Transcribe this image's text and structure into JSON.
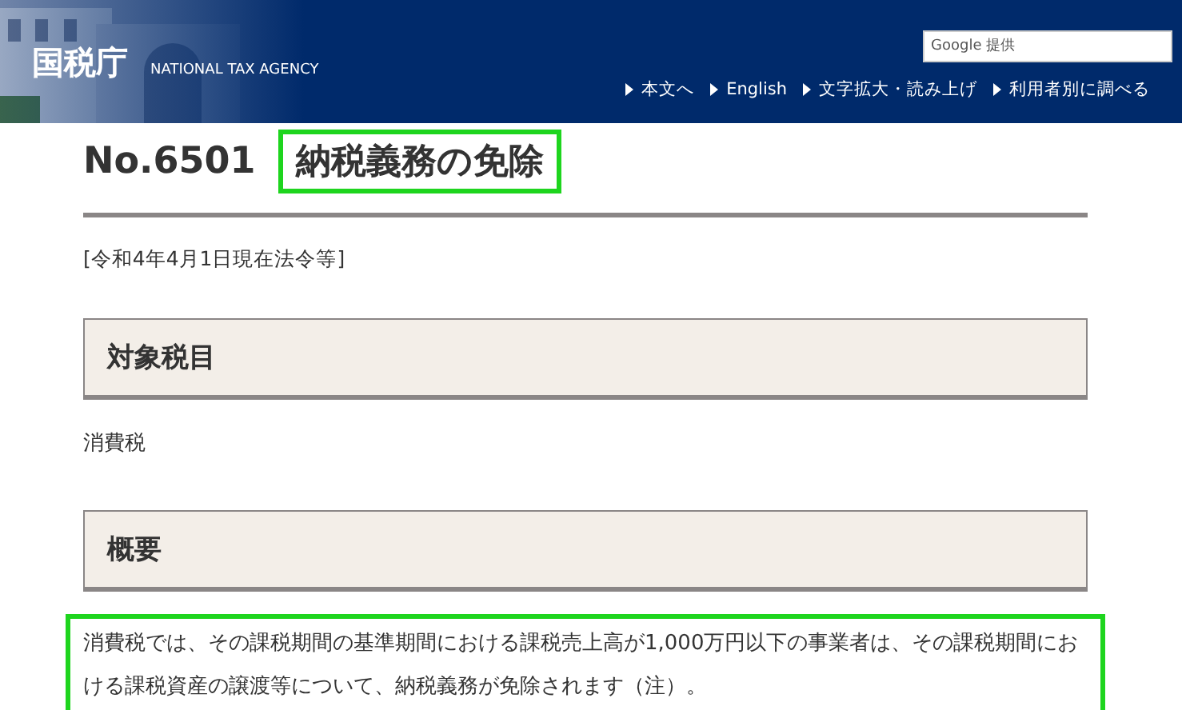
{
  "header": {
    "logo": "国税庁",
    "subtitle": "NATIONAL TAX AGENCY",
    "search": {
      "placeholder": "Google 提供"
    },
    "nav": [
      {
        "label": "本文へ"
      },
      {
        "label": "English"
      },
      {
        "label": "文字拡大・読み上げ"
      },
      {
        "label": "利用者別に調べる"
      }
    ]
  },
  "page": {
    "number": "No.6501",
    "title": {
      "text": "納税義務の免除",
      "highlighted": true
    },
    "date": "[令和4年4月1日現在法令等]",
    "sections": [
      {
        "heading": "対象税目",
        "body": {
          "text": "消費税",
          "highlighted": false
        }
      },
      {
        "heading": "概要",
        "body": {
          "text": "消費税では、その課税期間の基準期間における課税売上高が1,000万円以下の事業者は、その課税期間における課税資産の譲渡等について、納税義務が免除されます（注）。",
          "highlighted": true
        }
      }
    ]
  }
}
